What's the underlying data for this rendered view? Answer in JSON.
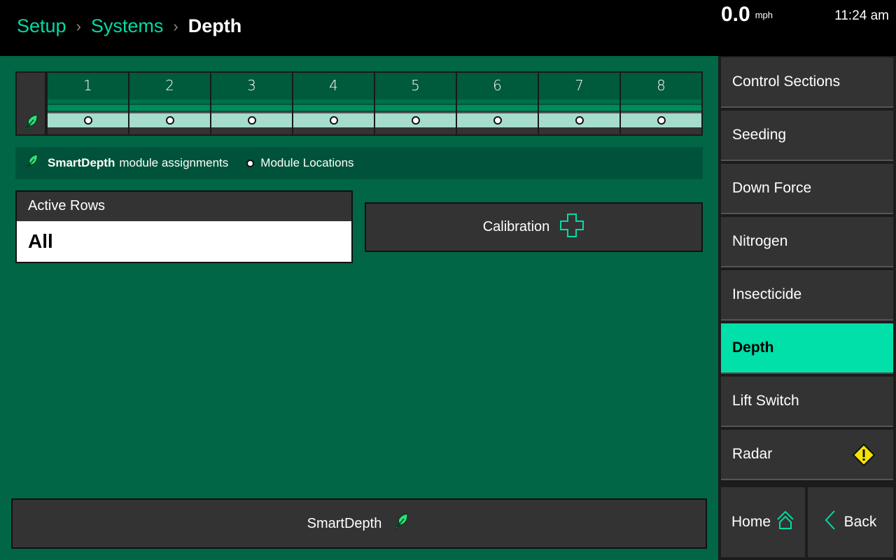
{
  "header": {
    "breadcrumbs": [
      "Setup",
      "Systems"
    ],
    "current": "Depth",
    "speed": "0.0",
    "speed_unit": "mph",
    "time": "11:24 am"
  },
  "row_grid": {
    "rows": [
      "1",
      "2",
      "3",
      "4",
      "5",
      "6",
      "7",
      "8"
    ]
  },
  "legend": {
    "assign_bold": "SmartDepth",
    "assign_text": "module assignments",
    "locations": "Module Locations"
  },
  "active_rows": {
    "label": "Active Rows",
    "value": "All"
  },
  "calibration": {
    "label": "Calibration"
  },
  "smartdepth": {
    "label": "SmartDepth"
  },
  "sidebar": {
    "items": [
      {
        "label": "Control Sections"
      },
      {
        "label": "Seeding"
      },
      {
        "label": "Down Force"
      },
      {
        "label": "Nitrogen"
      },
      {
        "label": "Insecticide"
      },
      {
        "label": "Depth"
      },
      {
        "label": "Lift Switch"
      },
      {
        "label": "Radar"
      }
    ],
    "active": "Depth",
    "home": "Home",
    "back": "Back"
  },
  "colors": {
    "accent": "#00e0a8",
    "background": "#006646",
    "warning": "#f5e400"
  }
}
